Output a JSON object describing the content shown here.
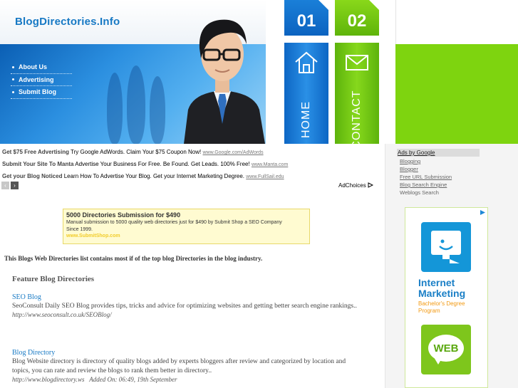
{
  "header": {
    "logo": "BlogDirectories.Info",
    "nav": [
      {
        "label": "About Us"
      },
      {
        "label": "Advertising"
      },
      {
        "label": "Submit Blog"
      }
    ],
    "tabs": [
      {
        "number": "01",
        "label": "HOME",
        "color": "#0c63c0"
      },
      {
        "number": "02",
        "label": "CONTACT",
        "color": "#5fb40a"
      }
    ],
    "accent_green": "#7ed40f",
    "accent_blue": "#1779c4"
  },
  "top_ads": [
    {
      "title": "Get $75 Free Advertising",
      "text": "Try Google AdWords. Claim Your $75 Coupon Now!",
      "url": "www.Google.com/AdWords"
    },
    {
      "title": "Submit Your Site To Manta",
      "text": "Advertise Your Business For Free. Be Found. Get Leads. 100% Free!",
      "url": "www.Manta.com"
    },
    {
      "title": "Get your Blog Noticed",
      "text": "Learn How To Advertise Your Blog. Get your Internet Marketing Degree.",
      "url": "www.FullSail.edu"
    }
  ],
  "pager": {
    "prev": "‹",
    "next": "›"
  },
  "adchoices": "AdChoices",
  "yellow_ad": {
    "title": "5000 Directories Submission for $490",
    "text": "Manual submission to 5000 quality web directories just for $490 by Submit Shop a SEO Company Since 1999.",
    "url": "www.SubmitShop.com"
  },
  "main": {
    "intro": "This Blogs Web Directories list contains most if of the top blog Directories in the blog industry.",
    "feature_title": "Feature Blog Directories",
    "entries": [
      {
        "title": "SEO Blog",
        "desc": "SeoConsult Daily SEO Blog provides tips, tricks and advice for optimizing websites and getting better search engine rankings..",
        "url": "http://www.seoconsult.co.uk/SEOBlog/",
        "added": ""
      },
      {
        "title": "Blog Directory",
        "desc": "Blog Website directory is directory of quality blogs added by experts bloggers after review and categorized by location and topics, you can rate and review the blogs to rank them better in directory..",
        "url": "http://www.blogdirectory.ws",
        "added": "Added On: 06:49, 19th September"
      }
    ]
  },
  "sidebar": {
    "ads_by_google": "Ads by Google",
    "links": [
      "Blogging",
      "Blogger",
      "Free URL Submission",
      "Blog Search Engine"
    ],
    "plain_link": "Weblogs Search",
    "banner": {
      "title_line1": "Internet",
      "title_line2": "Marketing",
      "sub_line1": "Bachelor's Degree",
      "sub_line2": "Program",
      "web_label": "WEB"
    }
  }
}
